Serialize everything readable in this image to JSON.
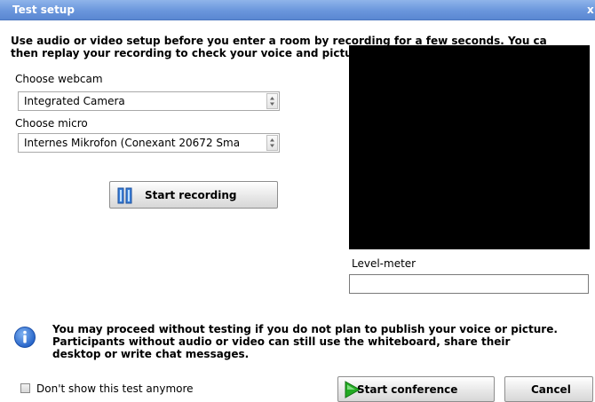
{
  "window": {
    "title": "Test setup",
    "close_label": "x"
  },
  "intro": {
    "line1": "Use audio or video setup before you enter a room by recording for a few seconds. You ca",
    "line2": "then replay your recording to check your voice and picture."
  },
  "webcam": {
    "label": "Choose webcam",
    "value": "Integrated Camera"
  },
  "micro": {
    "label": "Choose micro",
    "value": "Internes Mikrofon (Conexant 20672 Sma"
  },
  "record_button": {
    "label": "Start recording",
    "icon": "record-icon"
  },
  "level_meter": {
    "label": "Level-meter"
  },
  "info": {
    "icon": "info-icon",
    "line1": "You may proceed without testing if you do not plan to publish your voice or picture.",
    "line2": "Participants without audio or video can still use the whiteboard, share their",
    "line3": "desktop or write chat messages."
  },
  "dont_show": {
    "label": "Don't show this test anymore",
    "checked": false
  },
  "start_conference": {
    "label": "Start conference",
    "icon": "play-arrow-icon"
  },
  "cancel": {
    "label": "Cancel"
  },
  "colors": {
    "title_bar": "#6a96dc",
    "info_blue": "#2f6fd6",
    "play_green": "#22aa22"
  }
}
